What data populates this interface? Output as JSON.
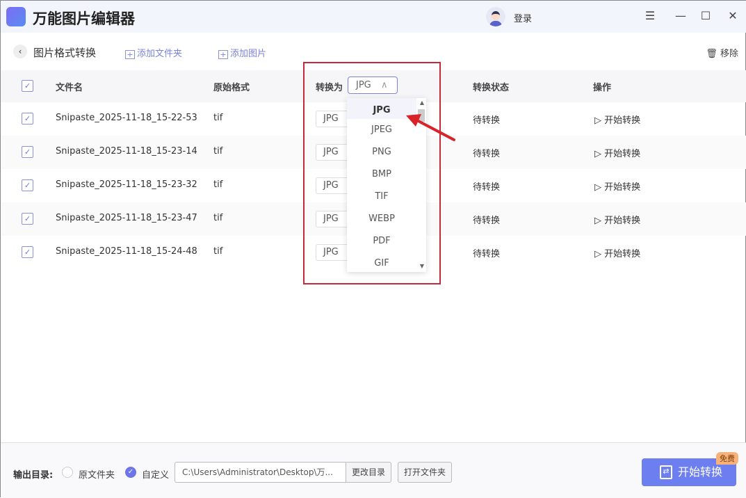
{
  "app": {
    "title": "万能图片编辑器",
    "login": "登录"
  },
  "toolbar": {
    "page_title": "图片格式转换",
    "add_folder": "添加文件夹",
    "add_image": "添加图片",
    "remove": "移除"
  },
  "table": {
    "headers": {
      "filename": "文件名",
      "orig_format": "原始格式",
      "convert_to": "转换为",
      "status": "转换状态",
      "action": "操作"
    },
    "header_select": "JPG",
    "rows": [
      {
        "name": "Snipaste_2025-11-18_15-22-53",
        "format": "tif",
        "target": "JPG",
        "status": "待转换",
        "action": "开始转换"
      },
      {
        "name": "Snipaste_2025-11-18_15-23-14",
        "format": "tif",
        "target": "JPG",
        "status": "待转换",
        "action": "开始转换"
      },
      {
        "name": "Snipaste_2025-11-18_15-23-32",
        "format": "tif",
        "target": "JPG",
        "status": "待转换",
        "action": "开始转换"
      },
      {
        "name": "Snipaste_2025-11-18_15-23-47",
        "format": "tif",
        "target": "JPG",
        "status": "待转换",
        "action": "开始转换"
      },
      {
        "name": "Snipaste_2025-11-18_15-24-48",
        "format": "tif",
        "target": "JPG",
        "status": "待转换",
        "action": "开始转换"
      }
    ]
  },
  "dropdown": {
    "options": [
      "JPG",
      "JPEG",
      "PNG",
      "BMP",
      "TIF",
      "WEBP",
      "PDF",
      "GIF"
    ],
    "selected": "JPG"
  },
  "bottom": {
    "label": "输出目录:",
    "opt_original": "原文件夹",
    "opt_custom": "自定义",
    "path": "C:\\Users\\Administrator\\Desktop\\万...",
    "change_dir": "更改目录",
    "open_folder": "打开文件夹",
    "start": "开始转换",
    "free_badge": "免费"
  },
  "colors": {
    "accent": "#6d7ef0",
    "highlight": "#c8283a"
  }
}
